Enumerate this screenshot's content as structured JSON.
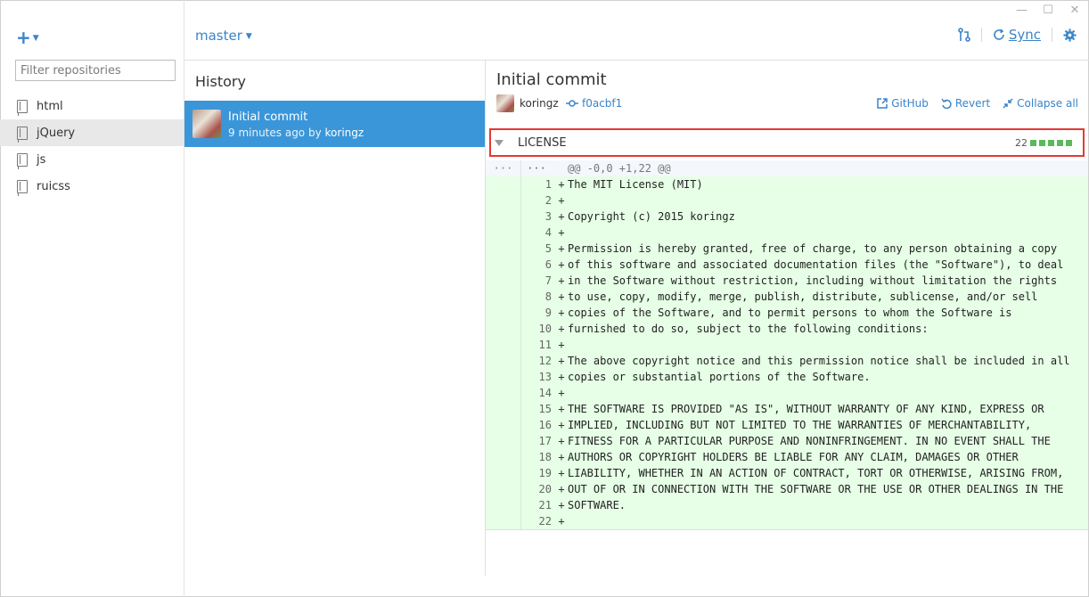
{
  "window": {
    "min_glyph": "—",
    "max_glyph": "☐",
    "close_glyph": "✕"
  },
  "sidebar": {
    "add_label": "+",
    "filter_placeholder": "Filter repositories",
    "repos": [
      {
        "label": "html"
      },
      {
        "label": "jQuery",
        "selected": true
      },
      {
        "label": "js"
      },
      {
        "label": "ruicss"
      }
    ]
  },
  "header": {
    "branch": "master",
    "sync_label": "Sync"
  },
  "history": {
    "title": "History",
    "commits": [
      {
        "title": "Initial commit",
        "time": "9 minutes ago by",
        "author": "koringz"
      }
    ]
  },
  "detail": {
    "title": "Initial commit",
    "author": "koringz",
    "sha": "f0acbf1",
    "actions": {
      "github": "GitHub",
      "revert": "Revert",
      "collapse": "Collapse all"
    },
    "file": {
      "name": "LICENSE",
      "additions": "22"
    },
    "hunk": {
      "old": "···",
      "new": "···",
      "text": "@@ -0,0 +1,22 @@"
    },
    "lines": [
      {
        "n": "1",
        "text": "The MIT License (MIT)"
      },
      {
        "n": "2",
        "text": ""
      },
      {
        "n": "3",
        "text": "Copyright (c) 2015 koringz"
      },
      {
        "n": "4",
        "text": ""
      },
      {
        "n": "5",
        "text": "Permission is hereby granted, free of charge, to any person obtaining a copy"
      },
      {
        "n": "6",
        "text": "of this software and associated documentation files (the \"Software\"), to deal"
      },
      {
        "n": "7",
        "text": "in the Software without restriction, including without limitation the rights"
      },
      {
        "n": "8",
        "text": "to use, copy, modify, merge, publish, distribute, sublicense, and/or sell"
      },
      {
        "n": "9",
        "text": "copies of the Software, and to permit persons to whom the Software is"
      },
      {
        "n": "10",
        "text": "furnished to do so, subject to the following conditions:"
      },
      {
        "n": "11",
        "text": ""
      },
      {
        "n": "12",
        "text": "The above copyright notice and this permission notice shall be included in all"
      },
      {
        "n": "13",
        "text": "copies or substantial portions of the Software."
      },
      {
        "n": "14",
        "text": ""
      },
      {
        "n": "15",
        "text": "THE SOFTWARE IS PROVIDED \"AS IS\", WITHOUT WARRANTY OF ANY KIND, EXPRESS OR"
      },
      {
        "n": "16",
        "text": "IMPLIED, INCLUDING BUT NOT LIMITED TO THE WARRANTIES OF MERCHANTABILITY,"
      },
      {
        "n": "17",
        "text": "FITNESS FOR A PARTICULAR PURPOSE AND NONINFRINGEMENT. IN NO EVENT SHALL THE"
      },
      {
        "n": "18",
        "text": "AUTHORS OR COPYRIGHT HOLDERS BE LIABLE FOR ANY CLAIM, DAMAGES OR OTHER"
      },
      {
        "n": "19",
        "text": "LIABILITY, WHETHER IN AN ACTION OF CONTRACT, TORT OR OTHERWISE, ARISING FROM,"
      },
      {
        "n": "20",
        "text": "OUT OF OR IN CONNECTION WITH THE SOFTWARE OR THE USE OR OTHER DEALINGS IN THE"
      },
      {
        "n": "21",
        "text": "SOFTWARE."
      },
      {
        "n": "22",
        "text": ""
      }
    ],
    "sign": "+"
  },
  "colors": {
    "accent": "#3a84c9",
    "selected_commit": "#3a96d9",
    "added_bg": "#e6ffe6",
    "highlight_border": "#e53935",
    "stat_green": "#5cb85c"
  },
  "icons": [
    "plus-icon",
    "repo-book-icon",
    "pull-request-icon",
    "sync-icon",
    "gear-icon",
    "commit-sha-icon",
    "external-link-icon",
    "revert-icon",
    "collapse-icon",
    "disclosure-triangle-icon"
  ]
}
